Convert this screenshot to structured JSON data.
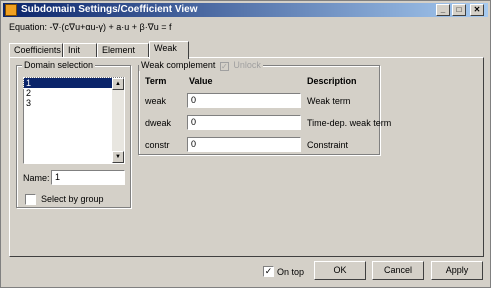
{
  "window": {
    "title": "Subdomain Settings/Coefficient View"
  },
  "equation": "Equation: -∇·(c∇u+αu-γ) + a·u + β·∇u = f",
  "tabs": [
    {
      "label": "Coefficients",
      "active": false
    },
    {
      "label": "Init",
      "active": false
    },
    {
      "label": "Element",
      "active": false
    },
    {
      "label": "Weak",
      "active": true
    }
  ],
  "domain_selection": {
    "label": "Domain selection",
    "items": [
      "1",
      "2",
      "3"
    ],
    "selected": "1",
    "name_label": "Name:",
    "name_value": "1",
    "select_by_group_label": "Select by group",
    "select_by_group_checked": false
  },
  "weak": {
    "header_label": "Weak complement",
    "unlock_label": "Unlock",
    "columns": {
      "term": "Term",
      "value": "Value",
      "description": "Description"
    },
    "rows": [
      {
        "term": "weak",
        "value": "0",
        "description": "Weak term"
      },
      {
        "term": "dweak",
        "value": "0",
        "description": "Time-dep. weak term"
      },
      {
        "term": "constr",
        "value": "0",
        "description": "Constraint"
      }
    ]
  },
  "footer": {
    "on_top_label": "On top",
    "on_top_checked": true,
    "ok_label": "OK",
    "cancel_label": "Cancel",
    "apply_label": "Apply"
  }
}
